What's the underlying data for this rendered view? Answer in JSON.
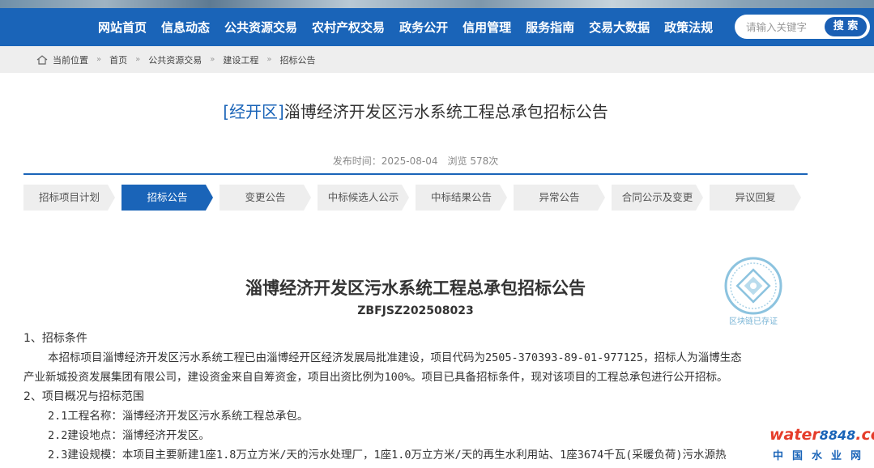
{
  "nav": {
    "items": [
      "网站首页",
      "信息动态",
      "公共资源交易",
      "农村产权交易",
      "政务公开",
      "信用管理",
      "服务指南",
      "交易大数据",
      "政策法规"
    ]
  },
  "search": {
    "placeholder": "请输入关键字",
    "button_label": "搜 索"
  },
  "breadcrumb": {
    "items": [
      "当前位置",
      "首页",
      "公共资源交易",
      "建设工程",
      "招标公告"
    ]
  },
  "header": {
    "title_tag": "[经开区]",
    "title_text": "淄博经济开发区污水系统工程总承包招标公告",
    "publish_time": "发布时间：2025-08-04",
    "views": "浏览 578次"
  },
  "tabs": [
    {
      "label": "招标项目计划",
      "active": false
    },
    {
      "label": "招标公告",
      "active": true
    },
    {
      "label": "变更公告",
      "active": false
    },
    {
      "label": "中标候选人公示",
      "active": false
    },
    {
      "label": "中标结果公告",
      "active": false
    },
    {
      "label": "异常公告",
      "active": false
    },
    {
      "label": "合同公示及变更",
      "active": false
    },
    {
      "label": "异议回复",
      "active": false
    }
  ],
  "document": {
    "title": "淄博经济开发区污水系统工程总承包招标公告",
    "code": "ZBFJSZ202508023",
    "seal_caption": "区块链已存证",
    "section1_heading": "1、招标条件",
    "section1_line1": "本招标项目淄博经济开发区污水系统工程已由淄博经开区经济发展局批准建设，项目代码为2505-370393-89-01-977125，招标人为淄博生态",
    "section1_line2": "产业新城投资发展集团有限公司，建设资金来自自筹资金，项目出资比例为100%。项目已具备招标条件，现对该项目的工程总承包进行公开招标。",
    "section2_heading": "2、项目概况与招标范围",
    "item_name": "2.1工程名称：淄博经济开发区污水系统工程总承包。",
    "item_location": "2.2建设地点：淄博经济开发区。",
    "item_scale": "2.3建设规模：本项目主要新建1座1.8万立方米/天的污水处理厂，1座1.0万立方米/天的再生水利用站、1座3674千瓦(采暖负荷)污水源热"
  },
  "watermark": {
    "brand": "water",
    "number": "8848",
    "suffix": ".com",
    "cn": "中国水业网"
  },
  "colors": {
    "primary": "#1a64b8",
    "tab_inactive": "#eeeeee",
    "seal": "#7ab5d6",
    "brand_red": "#e53c2a"
  }
}
